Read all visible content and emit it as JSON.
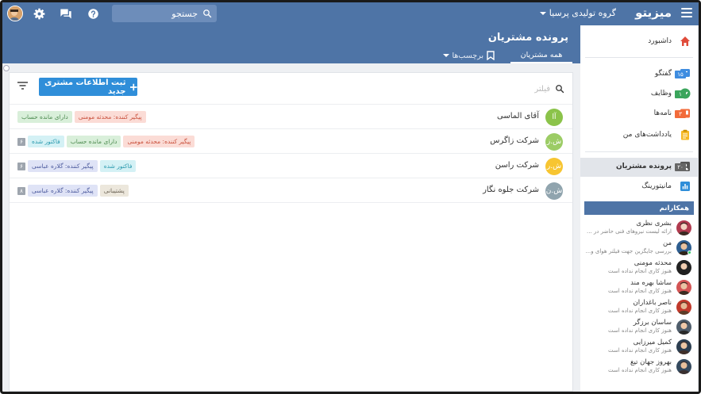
{
  "app": {
    "brand": "میزیتو",
    "org": "گروه تولیدی پرسیا",
    "search_placeholder": "جستجو",
    "colors": {
      "primary": "#4e74a6",
      "accent": "#2f8ed9"
    },
    "icons": [
      "menu-icon",
      "search-icon",
      "help-icon",
      "chat-icon",
      "gear-icon",
      "avatar"
    ]
  },
  "page": {
    "title": "پرونده مشتریان",
    "tabs": {
      "all": "همه مشتریان",
      "labels": "برچسب‌ها"
    },
    "add_button": "ثبت اطلاعات مشتری جدید",
    "filter_placeholder": "فیلتر"
  },
  "customers": [
    {
      "name": "آقای الماسی",
      "initials": "آا",
      "color": "#8bc34a",
      "tags": [
        {
          "text": "دارای مانده حساب",
          "style": "green"
        },
        {
          "text": "پیگیر کننده: محدثه مومنی",
          "style": "red"
        }
      ],
      "count": ""
    },
    {
      "name": "شرکت زاگرس",
      "initials": "ش.ز",
      "color": "#9ccc65",
      "tags": [
        {
          "text": "فاکتور شده",
          "style": "cyan"
        },
        {
          "text": "دارای مانده حساب",
          "style": "green"
        },
        {
          "text": "پیگیر کننده: محدثه مومنی",
          "style": "red"
        }
      ],
      "count": "۶"
    },
    {
      "name": "شرکت راسن",
      "initials": "ش.ر",
      "color": "#f7c531",
      "tags": [
        {
          "text": "پیگیر کننده: گلاره عباسی",
          "style": "blue"
        },
        {
          "text": "فاکتور شده",
          "style": "cyan"
        }
      ],
      "count": "۶"
    },
    {
      "name": "شرکت جلوه نگار",
      "initials": "ش.ن",
      "color": "#90a4ae",
      "tags": [
        {
          "text": "پیگیر کننده: گلاره عباسی",
          "style": "blue"
        },
        {
          "text": "پشتیبانی",
          "style": "tan"
        }
      ],
      "count": "۸"
    }
  ],
  "sidebar": {
    "dashboard": "داشبورد",
    "conversations": {
      "label": "گفتگو",
      "badge": "۱۵"
    },
    "tasks": {
      "label": "وظایف",
      "badge": "۱"
    },
    "letters": {
      "label": "نامه‌ها",
      "badge": "۳"
    },
    "notes": "یادداشت‌های من",
    "customers": {
      "label": "پرونده مشتریان",
      "badge": "۲۰"
    },
    "monitoring": "مانیتورینگ",
    "team_title": "همکارانم",
    "members": [
      {
        "name": "بشری نظری",
        "status": "ارائه لیست نیروهای فنی حاضر در ..."
      },
      {
        "name": "من",
        "status": "بررسی جایگزین جهت فیلتر هوای و..."
      },
      {
        "name": "محدثه مومنی",
        "status": "هنوز کاری انجام نداده است"
      },
      {
        "name": "ساشا بهره مند",
        "status": "هنوز کاری انجام نداده است"
      },
      {
        "name": "ناصر باغداران",
        "status": "هنوز کاری انجام نداده است"
      },
      {
        "name": "ساسان برزگر",
        "status": "هنوز کاری انجام نداده است"
      },
      {
        "name": "کمیل میرزایی",
        "status": "هنوز کاری انجام نداده است"
      },
      {
        "name": "بهروز جهان تیغ",
        "status": "هنوز کاری انجام نداده است"
      }
    ]
  }
}
